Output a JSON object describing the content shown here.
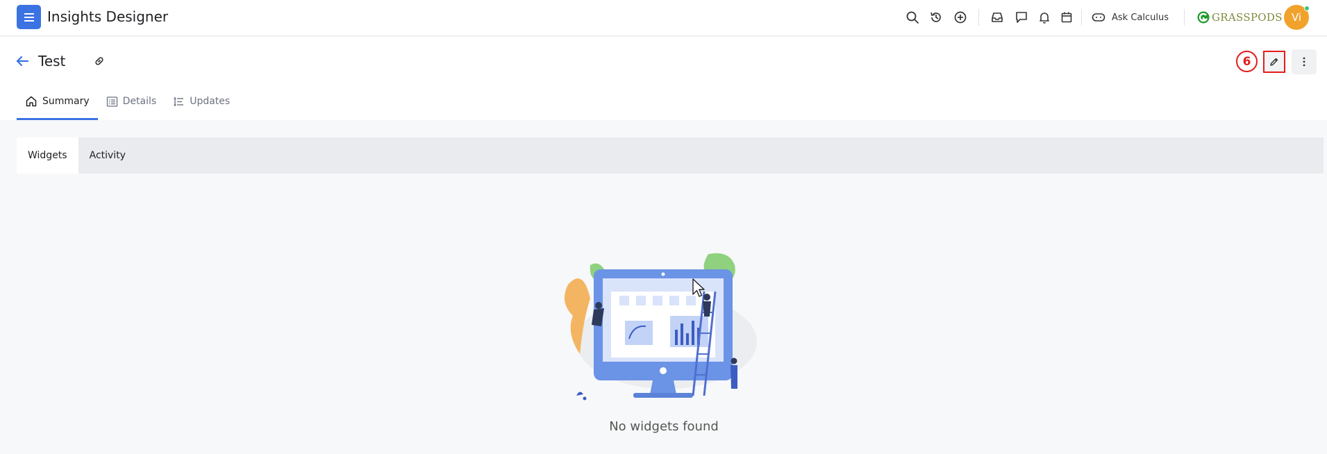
{
  "app": {
    "title": "Insights Designer",
    "ask_label": "Ask Calculus",
    "brand_name": "GRASSPODS",
    "avatar_initials": "Vi",
    "accent_color": "#3b73e3"
  },
  "toolbar": {
    "icons": [
      "search-icon",
      "history-icon",
      "add-circle-icon",
      "inbox-icon",
      "chat-icon",
      "bell-icon",
      "calendar-icon",
      "gamepad-icon"
    ]
  },
  "page": {
    "title": "Test",
    "annotation_number": "6",
    "tabs": [
      {
        "label": "Summary",
        "icon": "home-icon",
        "active": true
      },
      {
        "label": "Details",
        "icon": "list-icon",
        "active": false
      },
      {
        "label": "Updates",
        "icon": "updates-icon",
        "active": false
      }
    ],
    "subtabs": [
      {
        "label": "Widgets",
        "active": true
      },
      {
        "label": "Activity",
        "active": false
      }
    ]
  },
  "empty_state": {
    "message": "No widgets found"
  }
}
